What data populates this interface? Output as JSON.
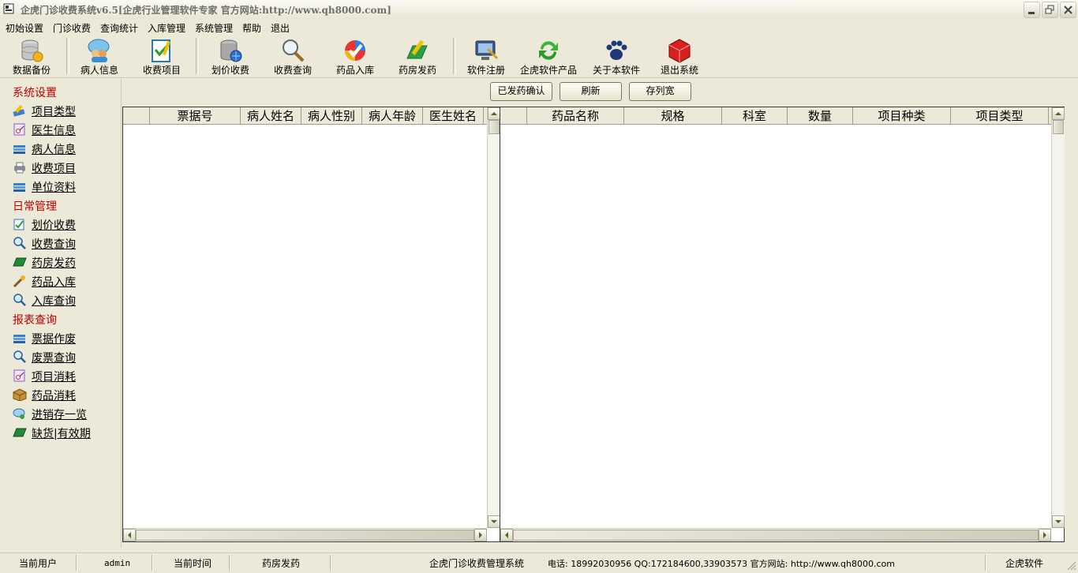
{
  "window": {
    "title": "企虎门诊收费系统v6.5[企虎行业管理软件专家 官方网站:http://www.qh8000.com]"
  },
  "menu": [
    "初始设置",
    "门诊收费",
    "查询统计",
    "入库管理",
    "系统管理",
    "帮助",
    "退出"
  ],
  "toolbar": [
    {
      "label": "数据备份",
      "icon": "database-icon"
    },
    {
      "label": "病人信息",
      "icon": "chat-people-icon"
    },
    {
      "label": "收费项目",
      "icon": "clipboard-check-icon"
    },
    {
      "label": "划价收费",
      "icon": "database-globe-icon"
    },
    {
      "label": "收费查询",
      "icon": "magnifier-icon"
    },
    {
      "label": "药品入库",
      "icon": "checkmark-ball-icon"
    },
    {
      "label": "药房发药",
      "icon": "folder-pencil-icon"
    },
    {
      "label": "软件注册",
      "icon": "monitor-register-icon"
    },
    {
      "label": "企虎软件产品",
      "icon": "refresh-icon"
    },
    {
      "label": "关于本软件",
      "icon": "tiger-paw-icon"
    },
    {
      "label": "退出系统",
      "icon": "red-cube-icon"
    }
  ],
  "sidebar": {
    "sections": [
      {
        "title": "系统设置",
        "items": [
          {
            "label": "项目类型",
            "icon": "pencil-book-icon"
          },
          {
            "label": "医生信息",
            "icon": "scissors-card-icon"
          },
          {
            "label": "病人信息",
            "icon": "stack-icon"
          },
          {
            "label": "收费项目",
            "icon": "printer-icon"
          },
          {
            "label": "单位资料",
            "icon": "stack-icon"
          }
        ]
      },
      {
        "title": "日常管理",
        "items": [
          {
            "label": "划价收费",
            "icon": "clipboard-icon"
          },
          {
            "label": "收费查询",
            "icon": "magnifier-icon"
          },
          {
            "label": "药房发药",
            "icon": "green-book-icon"
          },
          {
            "label": "药品入库",
            "icon": "wand-icon"
          },
          {
            "label": "入库查询",
            "icon": "magnifier-icon"
          }
        ]
      },
      {
        "title": "报表查询",
        "items": [
          {
            "label": "票据作废",
            "icon": "stack-icon"
          },
          {
            "label": "废票查询",
            "icon": "magnifier-icon"
          },
          {
            "label": "项目消耗",
            "icon": "scissors-card-icon"
          },
          {
            "label": "药品消耗",
            "icon": "box-icon"
          },
          {
            "label": "进销存一览",
            "icon": "chat-icon"
          },
          {
            "label": "缺货|有效期",
            "icon": "green-book-icon"
          }
        ]
      }
    ]
  },
  "actions": {
    "confirm": "已发药确认",
    "refresh": "刷新",
    "save_width": "存列宽"
  },
  "left_table": {
    "columns": [
      "",
      "票据号",
      "病人姓名",
      "病人性别",
      "病人年龄",
      "医生姓名"
    ]
  },
  "right_table": {
    "columns": [
      "",
      "药品名称",
      "规格",
      "科室",
      "数量",
      "项目种类",
      "项目类型"
    ]
  },
  "status": {
    "user_label": "当前用户",
    "user": "admin",
    "time_label": "当前时间",
    "module": "药房发药",
    "system": "企虎门诊收费管理系统",
    "contact": "电话: 18992030956 QQ:172184600,33903573  官方网站: http://www.qh8000.com",
    "company": "企虎软件"
  },
  "colors": {
    "section_title": "#c00000",
    "background": "#ece9d8"
  }
}
